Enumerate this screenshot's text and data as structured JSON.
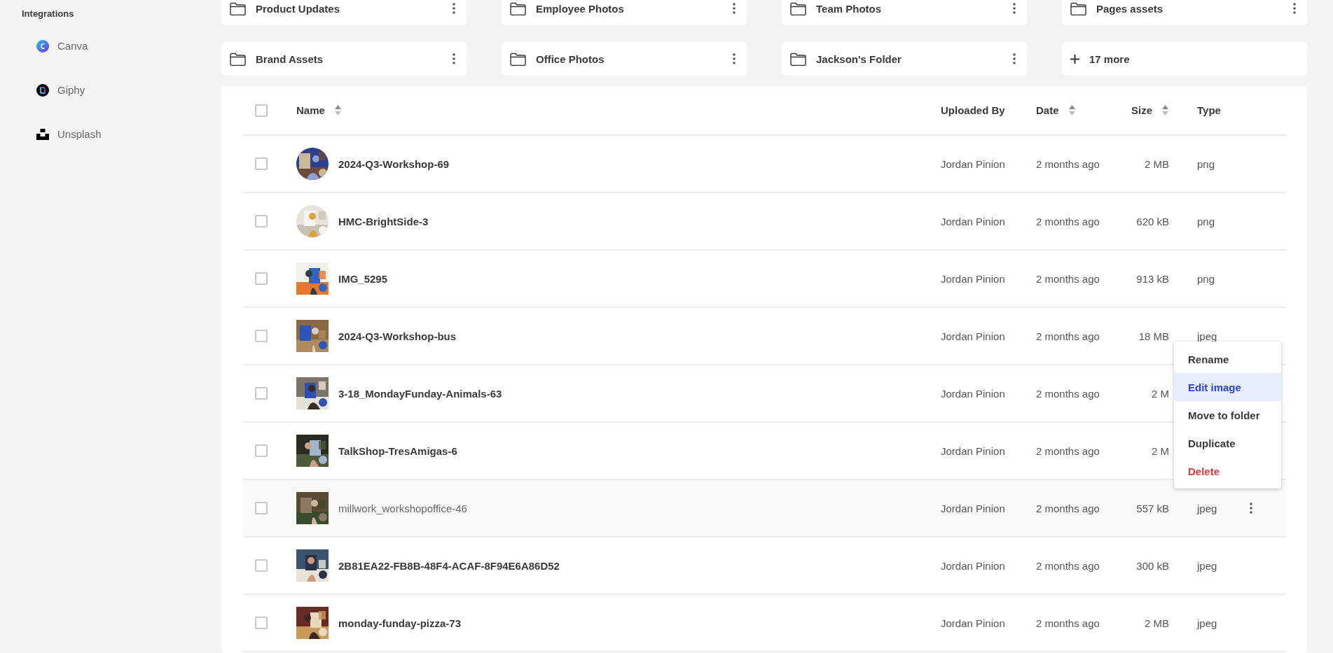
{
  "sidebar": {
    "section_title": "Integrations",
    "items": [
      {
        "label": "Canva",
        "kind": "canva"
      },
      {
        "label": "Giphy",
        "kind": "giphy"
      },
      {
        "label": "Unsplash",
        "kind": "unsplash"
      }
    ]
  },
  "folders": [
    {
      "name": "Product Updates",
      "kind": "folder"
    },
    {
      "name": "Employee Photos",
      "kind": "folder"
    },
    {
      "name": "Team Photos",
      "kind": "folder"
    },
    {
      "name": "Pages assets",
      "kind": "folder"
    },
    {
      "name": "Brand Assets",
      "kind": "folder"
    },
    {
      "name": "Office Photos",
      "kind": "folder"
    },
    {
      "name": "Jackson's Folder",
      "kind": "folder"
    },
    {
      "name": "17 more",
      "kind": "more"
    }
  ],
  "table": {
    "select_all_checked": false,
    "columns": [
      {
        "label": "Name",
        "sortable": true
      },
      {
        "label": "Uploaded By",
        "sortable": false
      },
      {
        "label": "Date",
        "sortable": true
      },
      {
        "label": "Size",
        "sortable": true
      },
      {
        "label": "Type",
        "sortable": false
      }
    ],
    "rows": [
      {
        "name": "2024-Q3-Workshop-69",
        "uploaded_by": "Jordan Pinion",
        "date": "2 months ago",
        "size": "2 MB",
        "type": "png",
        "checked": false,
        "hovered": false,
        "round_thumbnail": true
      },
      {
        "name": "HMC-BrightSide-3",
        "uploaded_by": "Jordan Pinion",
        "date": "2 months ago",
        "size": "620 kB",
        "type": "png",
        "checked": false,
        "hovered": false,
        "round_thumbnail": true
      },
      {
        "name": "IMG_5295",
        "uploaded_by": "Jordan Pinion",
        "date": "2 months ago",
        "size": "913 kB",
        "type": "png",
        "checked": false,
        "hovered": false,
        "round_thumbnail": false
      },
      {
        "name": "2024-Q3-Workshop-bus",
        "uploaded_by": "Jordan Pinion",
        "date": "2 months ago",
        "size": "18 MB",
        "type": "jpeg",
        "checked": false,
        "hovered": false,
        "round_thumbnail": false
      },
      {
        "name": "3-18_MondayFunday-Animals-63",
        "uploaded_by": "Jordan Pinion",
        "date": "2 months ago",
        "size": "2 M",
        "checked": false,
        "hovered": false,
        "round_thumbnail": false
      },
      {
        "name": "TalkShop-TresAmigas-6",
        "uploaded_by": "Jordan Pinion",
        "date": "2 months ago",
        "size": "2 M",
        "checked": false,
        "hovered": false,
        "round_thumbnail": false
      },
      {
        "name": "millwork_workshopoffice-46",
        "uploaded_by": "Jordan Pinion",
        "date": "2 months ago",
        "size": "557 kB",
        "type": "jpeg",
        "checked": false,
        "hovered": true,
        "round_thumbnail": false
      },
      {
        "name": "2B81EA22-FB8B-48F4-ACAF-8F94E6A86D52",
        "uploaded_by": "Jordan Pinion",
        "date": "2 months ago",
        "size": "300 kB",
        "type": "jpeg",
        "checked": false,
        "hovered": false,
        "round_thumbnail": false
      },
      {
        "name": "monday-funday-pizza-73",
        "uploaded_by": "Jordan Pinion",
        "date": "2 months ago",
        "size": "2 MB",
        "type": "jpeg",
        "checked": false,
        "hovered": false,
        "round_thumbnail": false
      }
    ]
  },
  "context_menu": {
    "items": [
      {
        "label": "Rename",
        "kind": "normal",
        "selected": false
      },
      {
        "label": "Edit image",
        "kind": "normal",
        "selected": true
      },
      {
        "label": "Move to folder",
        "kind": "normal",
        "selected": false
      },
      {
        "label": "Duplicate",
        "kind": "normal",
        "selected": false
      },
      {
        "label": "Delete",
        "kind": "danger",
        "selected": false
      }
    ]
  }
}
